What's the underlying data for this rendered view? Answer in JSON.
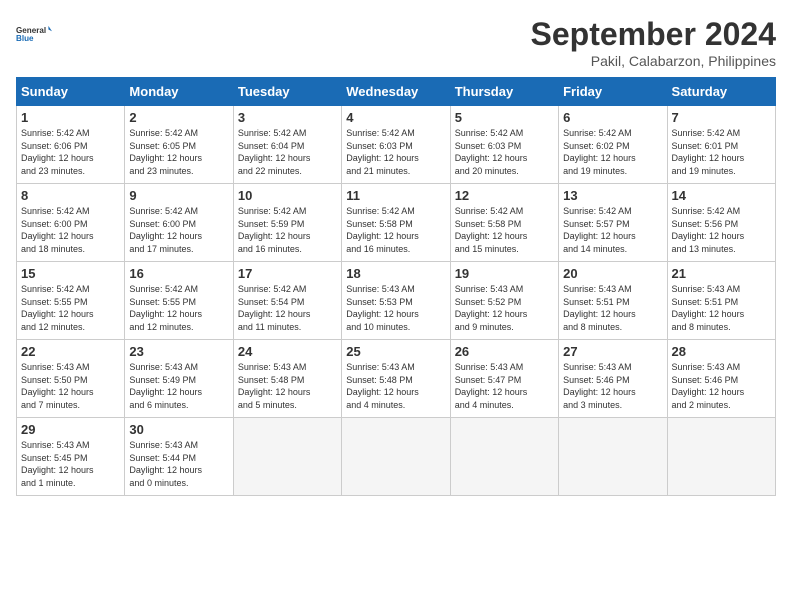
{
  "logo": {
    "line1": "General",
    "line2": "Blue"
  },
  "title": "September 2024",
  "location": "Pakil, Calabarzon, Philippines",
  "days_header": [
    "Sunday",
    "Monday",
    "Tuesday",
    "Wednesday",
    "Thursday",
    "Friday",
    "Saturday"
  ],
  "weeks": [
    [
      {
        "num": "1",
        "info": "Sunrise: 5:42 AM\nSunset: 6:06 PM\nDaylight: 12 hours\nand 23 minutes."
      },
      {
        "num": "2",
        "info": "Sunrise: 5:42 AM\nSunset: 6:05 PM\nDaylight: 12 hours\nand 23 minutes."
      },
      {
        "num": "3",
        "info": "Sunrise: 5:42 AM\nSunset: 6:04 PM\nDaylight: 12 hours\nand 22 minutes."
      },
      {
        "num": "4",
        "info": "Sunrise: 5:42 AM\nSunset: 6:03 PM\nDaylight: 12 hours\nand 21 minutes."
      },
      {
        "num": "5",
        "info": "Sunrise: 5:42 AM\nSunset: 6:03 PM\nDaylight: 12 hours\nand 20 minutes."
      },
      {
        "num": "6",
        "info": "Sunrise: 5:42 AM\nSunset: 6:02 PM\nDaylight: 12 hours\nand 19 minutes."
      },
      {
        "num": "7",
        "info": "Sunrise: 5:42 AM\nSunset: 6:01 PM\nDaylight: 12 hours\nand 19 minutes."
      }
    ],
    [
      {
        "num": "8",
        "info": "Sunrise: 5:42 AM\nSunset: 6:00 PM\nDaylight: 12 hours\nand 18 minutes."
      },
      {
        "num": "9",
        "info": "Sunrise: 5:42 AM\nSunset: 6:00 PM\nDaylight: 12 hours\nand 17 minutes."
      },
      {
        "num": "10",
        "info": "Sunrise: 5:42 AM\nSunset: 5:59 PM\nDaylight: 12 hours\nand 16 minutes."
      },
      {
        "num": "11",
        "info": "Sunrise: 5:42 AM\nSunset: 5:58 PM\nDaylight: 12 hours\nand 16 minutes."
      },
      {
        "num": "12",
        "info": "Sunrise: 5:42 AM\nSunset: 5:58 PM\nDaylight: 12 hours\nand 15 minutes."
      },
      {
        "num": "13",
        "info": "Sunrise: 5:42 AM\nSunset: 5:57 PM\nDaylight: 12 hours\nand 14 minutes."
      },
      {
        "num": "14",
        "info": "Sunrise: 5:42 AM\nSunset: 5:56 PM\nDaylight: 12 hours\nand 13 minutes."
      }
    ],
    [
      {
        "num": "15",
        "info": "Sunrise: 5:42 AM\nSunset: 5:55 PM\nDaylight: 12 hours\nand 12 minutes."
      },
      {
        "num": "16",
        "info": "Sunrise: 5:42 AM\nSunset: 5:55 PM\nDaylight: 12 hours\nand 12 minutes."
      },
      {
        "num": "17",
        "info": "Sunrise: 5:42 AM\nSunset: 5:54 PM\nDaylight: 12 hours\nand 11 minutes."
      },
      {
        "num": "18",
        "info": "Sunrise: 5:43 AM\nSunset: 5:53 PM\nDaylight: 12 hours\nand 10 minutes."
      },
      {
        "num": "19",
        "info": "Sunrise: 5:43 AM\nSunset: 5:52 PM\nDaylight: 12 hours\nand 9 minutes."
      },
      {
        "num": "20",
        "info": "Sunrise: 5:43 AM\nSunset: 5:51 PM\nDaylight: 12 hours\nand 8 minutes."
      },
      {
        "num": "21",
        "info": "Sunrise: 5:43 AM\nSunset: 5:51 PM\nDaylight: 12 hours\nand 8 minutes."
      }
    ],
    [
      {
        "num": "22",
        "info": "Sunrise: 5:43 AM\nSunset: 5:50 PM\nDaylight: 12 hours\nand 7 minutes."
      },
      {
        "num": "23",
        "info": "Sunrise: 5:43 AM\nSunset: 5:49 PM\nDaylight: 12 hours\nand 6 minutes."
      },
      {
        "num": "24",
        "info": "Sunrise: 5:43 AM\nSunset: 5:48 PM\nDaylight: 12 hours\nand 5 minutes."
      },
      {
        "num": "25",
        "info": "Sunrise: 5:43 AM\nSunset: 5:48 PM\nDaylight: 12 hours\nand 4 minutes."
      },
      {
        "num": "26",
        "info": "Sunrise: 5:43 AM\nSunset: 5:47 PM\nDaylight: 12 hours\nand 4 minutes."
      },
      {
        "num": "27",
        "info": "Sunrise: 5:43 AM\nSunset: 5:46 PM\nDaylight: 12 hours\nand 3 minutes."
      },
      {
        "num": "28",
        "info": "Sunrise: 5:43 AM\nSunset: 5:46 PM\nDaylight: 12 hours\nand 2 minutes."
      }
    ],
    [
      {
        "num": "29",
        "info": "Sunrise: 5:43 AM\nSunset: 5:45 PM\nDaylight: 12 hours\nand 1 minute."
      },
      {
        "num": "30",
        "info": "Sunrise: 5:43 AM\nSunset: 5:44 PM\nDaylight: 12 hours\nand 0 minutes."
      },
      {
        "num": "",
        "info": ""
      },
      {
        "num": "",
        "info": ""
      },
      {
        "num": "",
        "info": ""
      },
      {
        "num": "",
        "info": ""
      },
      {
        "num": "",
        "info": ""
      }
    ]
  ]
}
